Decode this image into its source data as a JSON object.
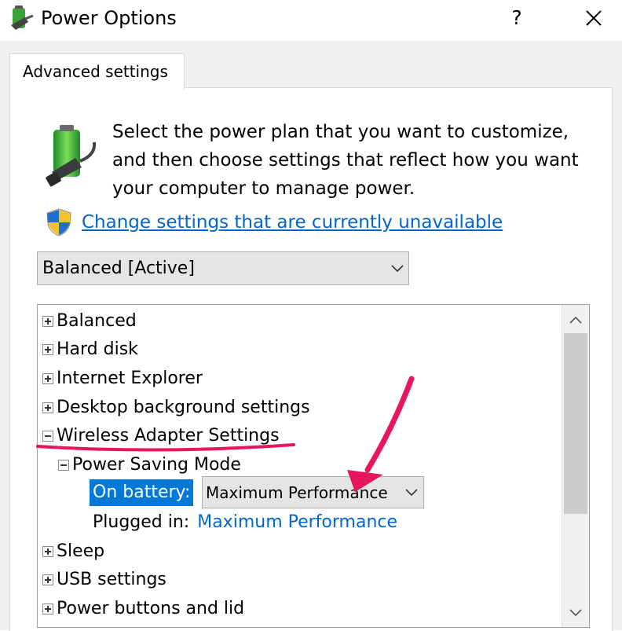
{
  "window": {
    "title": "Power Options",
    "help_label": "?",
    "close_label": "✕"
  },
  "tabs": [
    {
      "label": "Advanced settings"
    }
  ],
  "intro_text": "Select the power plan that you want to customize, and then choose settings that reflect how you want your computer to manage power.",
  "change_link": "Change settings that are currently unavailable",
  "plan_select": {
    "value": "Balanced [Active]"
  },
  "tree": {
    "items": [
      {
        "label": "Balanced",
        "expanded": false
      },
      {
        "label": "Hard disk",
        "expanded": false
      },
      {
        "label": "Internet Explorer",
        "expanded": false
      },
      {
        "label": "Desktop background settings",
        "expanded": false
      },
      {
        "label": "Wireless Adapter Settings",
        "expanded": true
      },
      {
        "label": "Power Saving Mode",
        "expanded": true
      },
      {
        "label": "Sleep",
        "expanded": false
      },
      {
        "label": "USB settings",
        "expanded": false
      },
      {
        "label": "Power buttons and lid",
        "expanded": false
      }
    ],
    "on_battery": {
      "label": "On battery:",
      "value": "Maximum Performance"
    },
    "plugged_in": {
      "label": "Plugged in:",
      "value": "Maximum Performance"
    }
  },
  "colors": {
    "accent": "#0078d7",
    "link": "#0066cc",
    "annotation": "#e8175d"
  },
  "icons": {
    "app": "power-plug-battery-icon",
    "battery": "battery-plug-icon",
    "shield": "uac-shield-icon",
    "dropdown": "chevron-down-icon",
    "scroll_up": "chevron-up-icon",
    "scroll_down": "chevron-down-icon"
  }
}
